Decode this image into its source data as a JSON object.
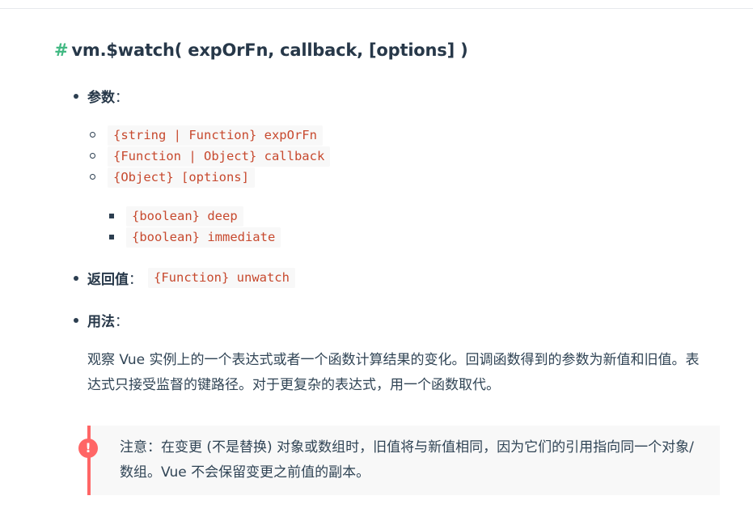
{
  "heading": {
    "hash": "#",
    "title": "vm.$watch( expOrFn, callback, [options] )"
  },
  "params": {
    "label": "参数",
    "colon": "：",
    "items": [
      "{string | Function} expOrFn",
      "{Function | Object} callback",
      "{Object} [options]"
    ],
    "options_items": [
      "{boolean} deep",
      "{boolean} immediate"
    ]
  },
  "returns": {
    "label": "返回值",
    "colon": "：",
    "value": "{Function} unwatch"
  },
  "usage": {
    "label": "用法",
    "colon": "：",
    "description": "观察 Vue 实例上的一个表达式或者一个函数计算结果的变化。回调函数得到的参数为新值和旧值。表达式只接受监督的键路径。对于更复杂的表达式，用一个函数取代。"
  },
  "tip": {
    "icon": "!",
    "icon_name": "exclamation-icon",
    "text": "注意：在变更 (不是替换) 对象或数组时，旧值将与新值相同，因为它们的引用指向同一个对象/数组。Vue 不会保留变更之前值的副本。",
    "accent": "#ff6666",
    "background": "#f8f8f8"
  },
  "colors": {
    "accent_green": "#42b983",
    "code_text": "#c7492e",
    "code_bg": "#f8f8f8"
  }
}
